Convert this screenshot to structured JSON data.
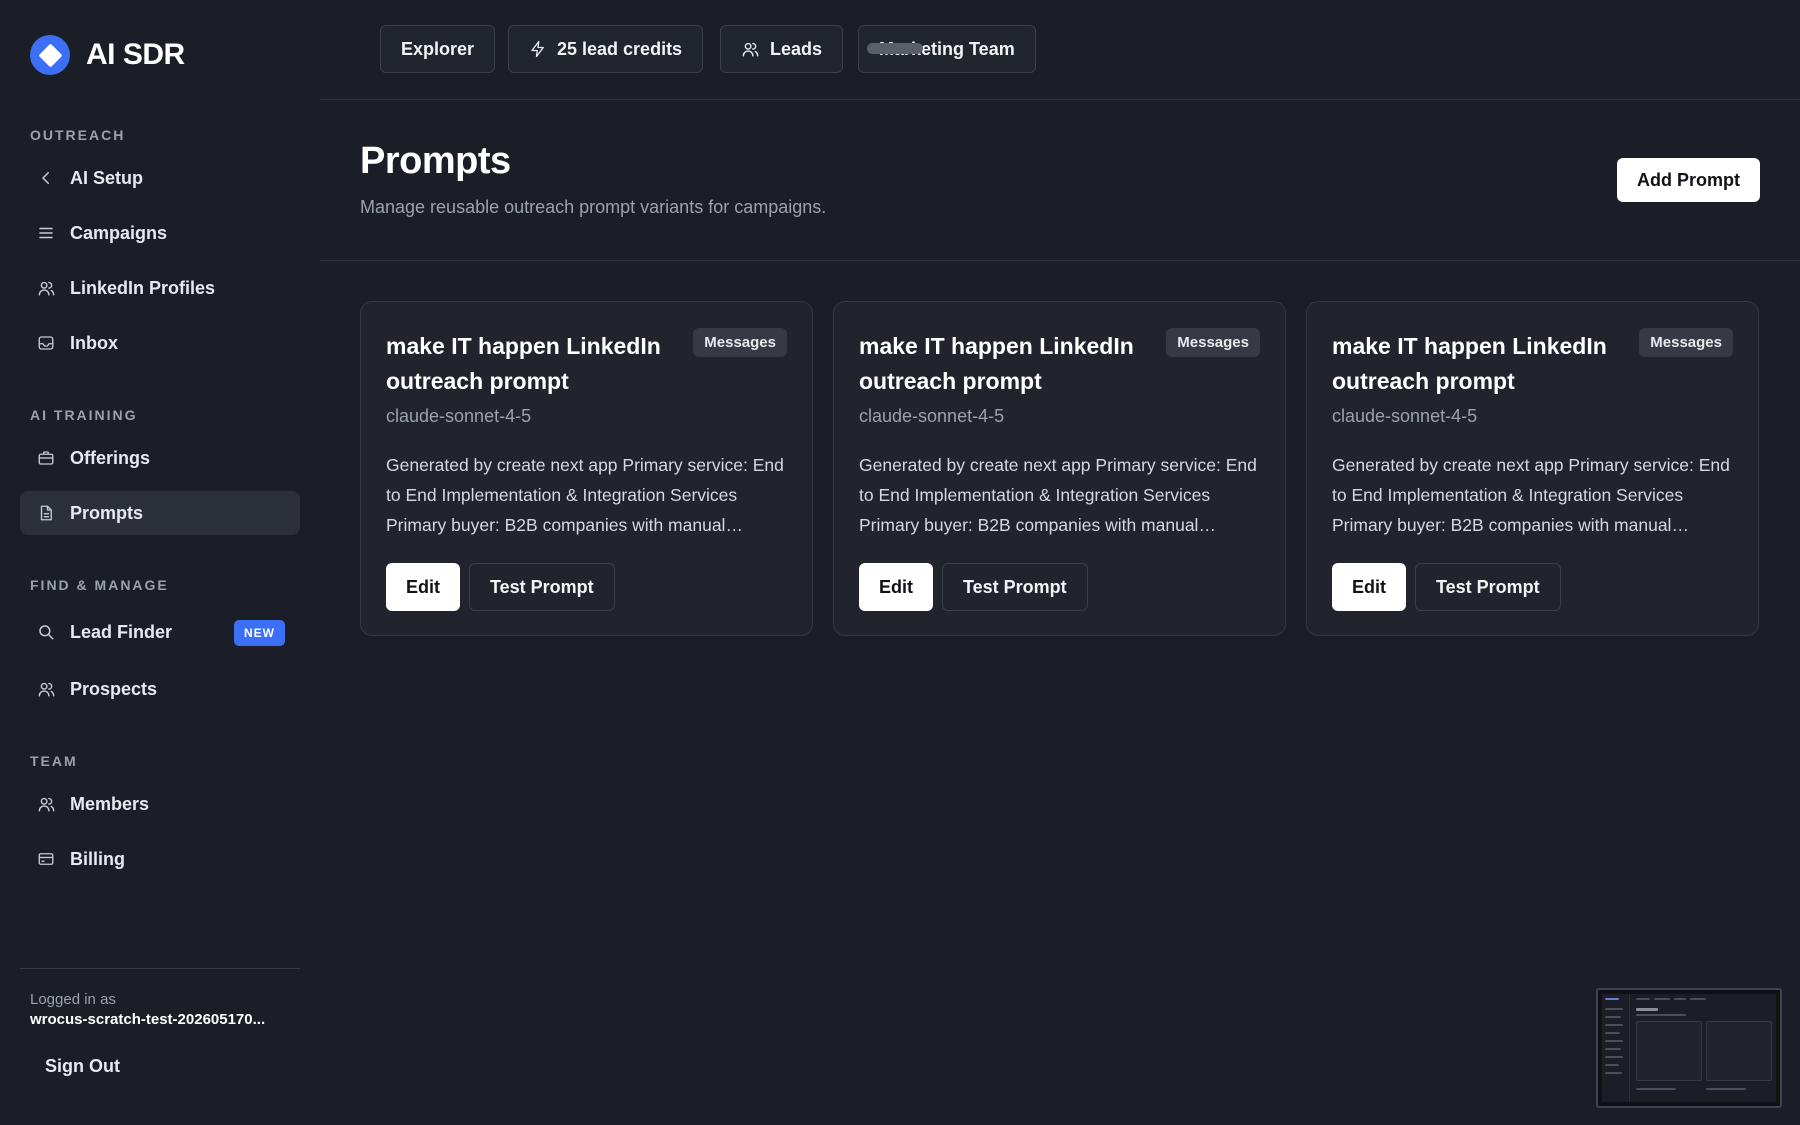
{
  "brand": {
    "name": "AI SDR"
  },
  "sidebar": {
    "sections": {
      "outreach": "OUTREACH",
      "ai_training": "AI TRAINING",
      "find_manage": "FIND & MANAGE",
      "team": "TEAM"
    },
    "items": {
      "ai_setup": {
        "label": "AI Setup",
        "icon": "chevron-left-icon"
      },
      "campaigns": {
        "label": "Campaigns",
        "icon": "list-icon"
      },
      "linkedin_profiles": {
        "label": "LinkedIn Profiles",
        "icon": "users-icon"
      },
      "inbox": {
        "label": "Inbox",
        "icon": "inbox-icon"
      },
      "offerings": {
        "label": "Offerings",
        "icon": "briefcase-icon"
      },
      "prompts": {
        "label": "Prompts",
        "icon": "document-icon",
        "active": true
      },
      "lead_finder": {
        "label": "Lead Finder",
        "icon": "search-icon",
        "badge": "NEW"
      },
      "prospects": {
        "label": "Prospects",
        "icon": "users-icon"
      },
      "members": {
        "label": "Members",
        "icon": "users-icon"
      },
      "billing": {
        "label": "Billing",
        "icon": "credit-card-icon"
      }
    },
    "footer": {
      "logged_in_label": "Logged in as",
      "user": "wrocus-scratch-test-202605170...",
      "sign_out": "Sign Out"
    }
  },
  "topbar": {
    "explorer": "Explorer",
    "credits": "25 lead credits",
    "leads": "Leads",
    "team": "Marketing Team"
  },
  "header": {
    "title": "Prompts",
    "subtitle": "Manage reusable outreach prompt variants for campaigns.",
    "add_button": "Add Prompt"
  },
  "cards": [
    {
      "title": "make IT happen LinkedIn outreach prompt",
      "badge": "Messages",
      "model": "claude-sonnet-4-5",
      "description": "Generated by create next app Primary service: End to End Implementation & Integration Services Primary buyer: B2B companies with manual…",
      "edit": "Edit",
      "test": "Test Prompt"
    },
    {
      "title": "make IT happen LinkedIn outreach prompt",
      "badge": "Messages",
      "model": "claude-sonnet-4-5",
      "description": "Generated by create next app Primary service: End to End Implementation & Integration Services Primary buyer: B2B companies with manual…",
      "edit": "Edit",
      "test": "Test Prompt"
    },
    {
      "title": "make IT happen LinkedIn outreach prompt",
      "badge": "Messages",
      "model": "claude-sonnet-4-5",
      "description": "Generated by create next app Primary service: End to End Implementation & Integration Services Primary buyer: B2B companies with manual…",
      "edit": "Edit",
      "test": "Test Prompt"
    }
  ],
  "colors": {
    "background": "#1b1e26",
    "card": "#21242c",
    "accent": "#3b6ff5",
    "muted_text": "#9aa2ae"
  }
}
